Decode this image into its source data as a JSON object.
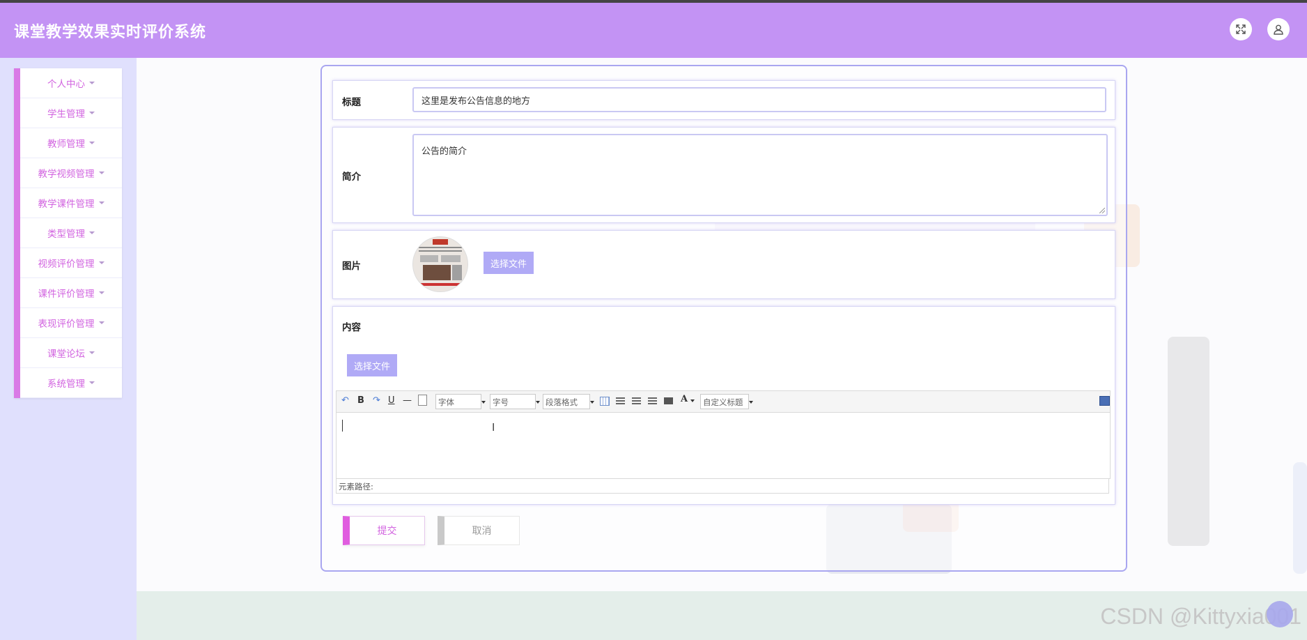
{
  "header": {
    "title": "课堂教学效果实时评价系统",
    "fullscreen_icon": "fullscreen-icon",
    "user_icon": "user-icon"
  },
  "sidebar": {
    "items": [
      {
        "label": "个人中心"
      },
      {
        "label": "学生管理"
      },
      {
        "label": "教师管理"
      },
      {
        "label": "教学视频管理"
      },
      {
        "label": "教学课件管理"
      },
      {
        "label": "类型管理"
      },
      {
        "label": "视频评价管理"
      },
      {
        "label": "课件评价管理"
      },
      {
        "label": "表现评价管理"
      },
      {
        "label": "课堂论坛"
      },
      {
        "label": "系统管理"
      }
    ]
  },
  "form": {
    "title_label": "标题",
    "title_value": "这里是发布公告信息的地方",
    "intro_label": "简介",
    "intro_value": "公告的简介",
    "image_label": "图片",
    "choose_file": "选择文件",
    "content_label": "内容",
    "content_choose_file": "选择文件",
    "toolbar": {
      "font": "字体",
      "size": "字号",
      "paragraph": "段落格式",
      "custom_title": "自定义标题",
      "bold": "B",
      "underline": "U",
      "font_color": "A"
    },
    "element_path": "元素路径:",
    "submit": "提交",
    "cancel": "取消"
  },
  "watermark": "CSDN @Kittyxia001",
  "colors": {
    "header": "#c393f4",
    "accent": "#d264e0",
    "sidebar_bg": "#e0e0fd",
    "button": "#b0aaf6"
  }
}
